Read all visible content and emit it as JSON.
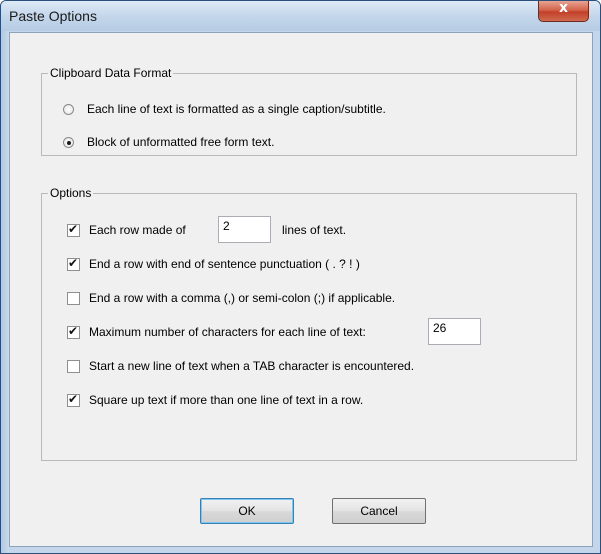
{
  "window": {
    "title": "Paste Options",
    "close_label": "x"
  },
  "clipboard_group": {
    "legend": "Clipboard Data Format",
    "options": [
      {
        "label": "Each line of text is formatted as a single caption/subtitle.",
        "selected": false
      },
      {
        "label": "Block of unformatted free form text.",
        "selected": true
      }
    ]
  },
  "options_group": {
    "legend": "Options",
    "row1": {
      "label_before": "Each row made of",
      "value": "2",
      "label_after": "lines of text.",
      "checked": true
    },
    "row2": {
      "label": "End a row with end of sentence punctuation  ( . ? ! )",
      "checked": true
    },
    "row3": {
      "label": "End a row with a comma (,) or semi-colon (;) if applicable.",
      "checked": false
    },
    "row4": {
      "label": "Maximum number of characters for each line of text:",
      "value": "26",
      "checked": true
    },
    "row5": {
      "label": "Start a new line of text when a TAB character is encountered.",
      "checked": false
    },
    "row6": {
      "label": "Square up text if more than one line of text in a row.",
      "checked": true
    }
  },
  "buttons": {
    "ok": "OK",
    "cancel": "Cancel"
  },
  "marks": {
    "check": "✔"
  }
}
